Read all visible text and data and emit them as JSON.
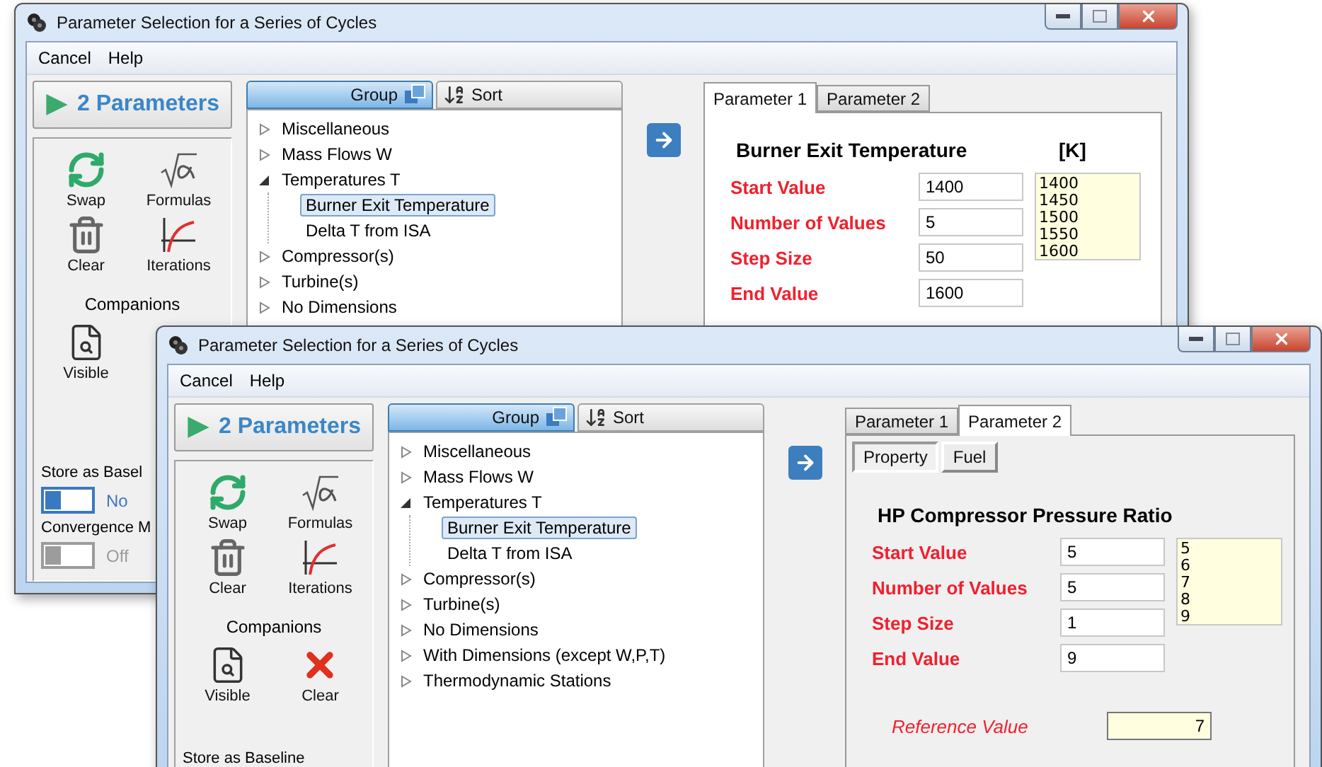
{
  "windows": [
    {
      "title": "Parameter Selection for a Series of Cycles",
      "menu": [
        "Cancel",
        "Help"
      ],
      "parameters_button": "2 Parameters",
      "tools": [
        {
          "kind": "swap",
          "label": "Swap"
        },
        {
          "kind": "formulas",
          "label": "Formulas"
        },
        {
          "kind": "trash",
          "label": "Clear"
        },
        {
          "kind": "iterations",
          "label": "Iterations"
        }
      ],
      "companions": {
        "heading": "Companions",
        "items": [
          {
            "kind": "visible",
            "label": "Visible"
          }
        ]
      },
      "settings": [
        {
          "label": "Store as Basel",
          "switch": {
            "label": "No",
            "on": false,
            "enabled": true
          }
        },
        {
          "label": "Convergence M",
          "switch": {
            "label": "Off",
            "on": false,
            "enabled": false
          }
        }
      ],
      "view_buttons": [
        {
          "kind": "group",
          "label": "Group",
          "selected": true
        },
        {
          "kind": "sort",
          "label": "Sort",
          "selected": false
        }
      ],
      "tree": [
        {
          "label": "Miscellaneous",
          "expanded": false,
          "selected": false
        },
        {
          "label": "Mass Flows W",
          "expanded": false,
          "selected": false
        },
        {
          "label": "Temperatures T",
          "expanded": true,
          "selected": false,
          "children": [
            {
              "label": "Burner Exit Temperature",
              "selected": true
            },
            {
              "label": "Delta T from ISA",
              "selected": false
            }
          ]
        },
        {
          "label": "Compressor(s)",
          "expanded": false,
          "selected": false
        },
        {
          "label": "Turbine(s)",
          "expanded": false,
          "selected": false
        },
        {
          "label": "No Dimensions",
          "expanded": false,
          "selected": false
        }
      ],
      "tabs": [
        {
          "label": "Parameter 1",
          "selected": true
        },
        {
          "label": "Parameter 2",
          "selected": false
        }
      ],
      "heading": "Burner Exit Temperature",
      "unit": "[K]",
      "fields": [
        {
          "label": "Start Value",
          "value": "1400"
        },
        {
          "label": "Number of Values",
          "value": "5"
        },
        {
          "label": "Step Size",
          "value": "50"
        },
        {
          "label": "End Value",
          "value": "1600"
        }
      ],
      "values_list": [
        "1400",
        "1450",
        "1500",
        "1550",
        "1600"
      ]
    },
    {
      "title": "Parameter Selection for a Series of Cycles",
      "menu": [
        "Cancel",
        "Help"
      ],
      "parameters_button": "2 Parameters",
      "tools": [
        {
          "kind": "swap",
          "label": "Swap"
        },
        {
          "kind": "formulas",
          "label": "Formulas"
        },
        {
          "kind": "trash",
          "label": "Clear"
        },
        {
          "kind": "iterations",
          "label": "Iterations"
        }
      ],
      "companions": {
        "heading": "Companions",
        "items": [
          {
            "kind": "visible",
            "label": "Visible"
          },
          {
            "kind": "cross",
            "label": "Clear"
          }
        ]
      },
      "settings": [
        {
          "label": "Store as Baseline"
        }
      ],
      "view_buttons": [
        {
          "kind": "group",
          "label": "Group",
          "selected": true
        },
        {
          "kind": "sort",
          "label": "Sort",
          "selected": false
        }
      ],
      "tree": [
        {
          "label": "Miscellaneous",
          "expanded": false,
          "selected": false
        },
        {
          "label": "Mass Flows W",
          "expanded": false,
          "selected": false
        },
        {
          "label": "Temperatures T",
          "expanded": true,
          "selected": false,
          "children": [
            {
              "label": "Burner Exit Temperature",
              "selected": true
            },
            {
              "label": "Delta T from ISA",
              "selected": false
            }
          ]
        },
        {
          "label": "Compressor(s)",
          "expanded": false,
          "selected": false
        },
        {
          "label": "Turbine(s)",
          "expanded": false,
          "selected": false
        },
        {
          "label": "No Dimensions",
          "expanded": false,
          "selected": false
        },
        {
          "label": "With Dimensions (except W,P,T)",
          "expanded": false,
          "selected": false
        },
        {
          "label": "Thermodynamic Stations",
          "expanded": false,
          "selected": false
        }
      ],
      "tabs": [
        {
          "label": "Parameter 1",
          "selected": false
        },
        {
          "label": "Parameter 2",
          "selected": true
        }
      ],
      "subtabs": [
        {
          "label": "Property",
          "selected": true
        },
        {
          "label": "Fuel",
          "selected": false
        }
      ],
      "heading": "HP Compressor Pressure Ratio",
      "fields": [
        {
          "label": "Start Value",
          "value": "5"
        },
        {
          "label": "Number of Values",
          "value": "5"
        },
        {
          "label": "Step Size",
          "value": "1"
        },
        {
          "label": "End Value",
          "value": "9"
        }
      ],
      "values_list": [
        "5",
        "6",
        "7",
        "8",
        "9"
      ],
      "reference": {
        "label": "Reference Value",
        "value": "7"
      }
    }
  ]
}
